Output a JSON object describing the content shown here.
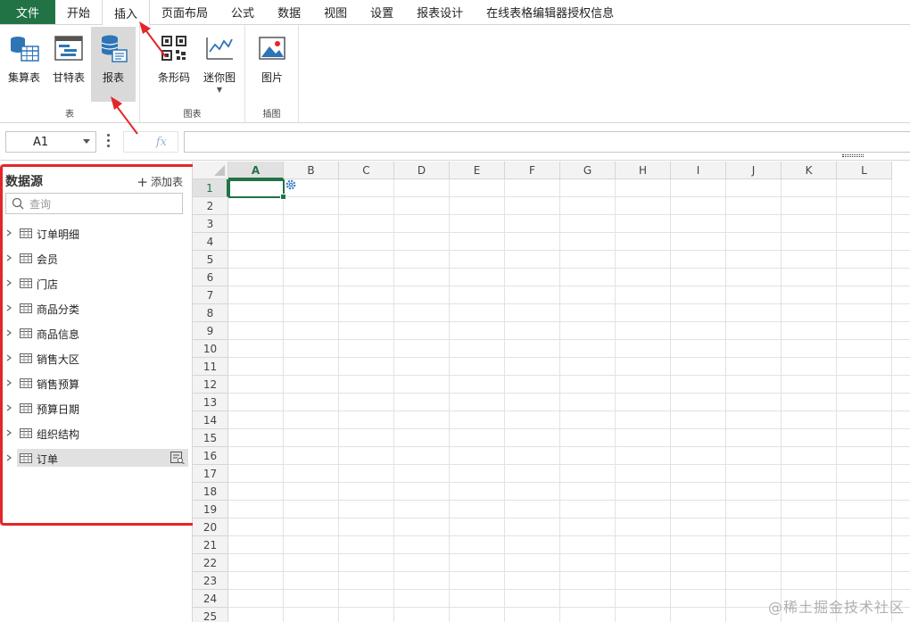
{
  "menu": {
    "tabs": [
      {
        "label": "文件"
      },
      {
        "label": "开始"
      },
      {
        "label": "插入"
      },
      {
        "label": "页面布局"
      },
      {
        "label": "公式"
      },
      {
        "label": "数据"
      },
      {
        "label": "视图"
      },
      {
        "label": "设置"
      },
      {
        "label": "报表设计"
      },
      {
        "label": "在线表格编辑器授权信息"
      }
    ],
    "active_tab": "插入"
  },
  "ribbon": {
    "groups": [
      {
        "label": "表",
        "buttons": [
          {
            "label": "集算表",
            "icon": "database-table-icon"
          },
          {
            "label": "甘特表",
            "icon": "gantt-icon"
          },
          {
            "label": "报表",
            "icon": "report-database-icon",
            "selected": true
          }
        ]
      },
      {
        "label": "图表",
        "buttons": [
          {
            "label": "条形码",
            "icon": "qrcode-icon"
          },
          {
            "label": "迷你图",
            "icon": "sparkline-icon",
            "has_dropdown": true
          }
        ]
      },
      {
        "label": "插图",
        "buttons": [
          {
            "label": "图片",
            "icon": "picture-icon"
          }
        ]
      }
    ]
  },
  "formula_bar": {
    "name_box": "A1",
    "fx": "fx",
    "formula": ""
  },
  "data_source": {
    "title": "数据源",
    "add_table": "添加表",
    "search_placeholder": "查询",
    "items": [
      {
        "name": "订单明细"
      },
      {
        "name": "会员"
      },
      {
        "name": "门店"
      },
      {
        "name": "商品分类"
      },
      {
        "name": "商品信息"
      },
      {
        "name": "销售大区"
      },
      {
        "name": "销售预算"
      },
      {
        "name": "预算日期"
      },
      {
        "name": "组织结构"
      },
      {
        "name": "订单",
        "selected": true
      }
    ]
  },
  "sheet": {
    "columns": [
      "A",
      "B",
      "C",
      "D",
      "E",
      "F",
      "G",
      "H",
      "I",
      "J",
      "K",
      "L"
    ],
    "rows": [
      "1",
      "2",
      "3",
      "4",
      "5",
      "6",
      "7",
      "8",
      "9",
      "10",
      "11",
      "12",
      "13",
      "14",
      "15",
      "16",
      "17",
      "18",
      "19",
      "20",
      "21",
      "22",
      "23",
      "24",
      "25"
    ],
    "active_cell": "A1"
  },
  "colors": {
    "accent_green": "#217346",
    "annotation_red": "#e3262a"
  },
  "watermark": "@稀土掘金技术社区"
}
